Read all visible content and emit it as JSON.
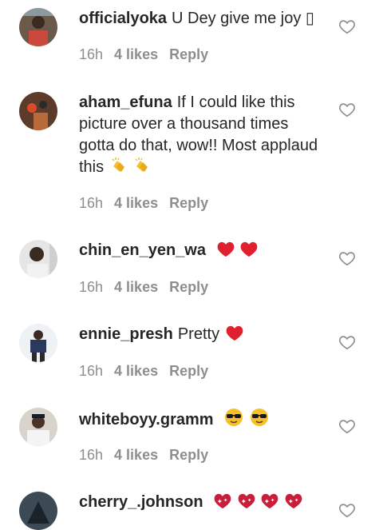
{
  "comments": [
    {
      "username": "officialyoka",
      "text": "U Dey give me joy ▯",
      "emojis": [],
      "time": "16h",
      "likes": "4 likes",
      "reply": "Reply"
    },
    {
      "username": "aham_efuna",
      "text": "If I could like this picture over a thousand times gotta do that, wow!! Most applaud this",
      "emojis": [
        "clapping-hands-icon",
        "clapping-hands-icon"
      ],
      "time": "16h",
      "likes": "4 likes",
      "reply": "Reply"
    },
    {
      "username": "chin_en_yen_wa",
      "text": "",
      "emojis": [
        "red-heart-icon",
        "red-heart-icon"
      ],
      "time": "16h",
      "likes": "4 likes",
      "reply": "Reply"
    },
    {
      "username": "ennie_presh",
      "text": "Pretty",
      "emojis": [
        "red-heart-icon"
      ],
      "time": "16h",
      "likes": "4 likes",
      "reply": "Reply"
    },
    {
      "username": "whiteboyy.gramm",
      "text": "",
      "emojis": [
        "sunglasses-face-icon",
        "sunglasses-face-icon"
      ],
      "time": "16h",
      "likes": "4 likes",
      "reply": "Reply"
    },
    {
      "username": "cherry_.johnson",
      "text": "",
      "emojis": [
        "sparkling-heart-icon",
        "sparkling-heart-icon",
        "sparkling-heart-icon",
        "sparkling-heart-icon"
      ],
      "time": "",
      "likes": "",
      "reply": ""
    }
  ],
  "colors": {
    "text": "#262626",
    "meta": "#8e8e8e",
    "heart": "#e0202e",
    "like_outline": "#8e8e8e"
  }
}
